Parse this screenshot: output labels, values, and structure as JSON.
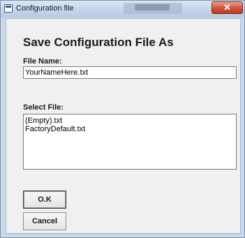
{
  "window": {
    "title": "Configuration file",
    "close_label": "✕"
  },
  "dialog": {
    "heading": "Save Configuration File As",
    "file_name_label": "File Name:",
    "file_name_value": "YourNameHere.txt",
    "select_file_label": "Select File:",
    "files": [
      "(Empty).txt",
      "FactoryDefault.txt"
    ],
    "ok_label": "O.K",
    "cancel_label": "Cancel"
  },
  "icons": {
    "app": "config-app-icon",
    "close": "close-icon"
  }
}
